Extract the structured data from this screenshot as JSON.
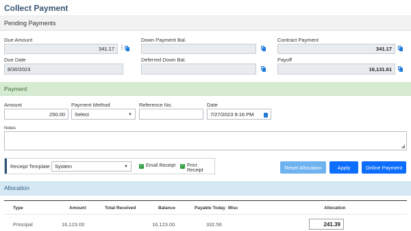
{
  "title": "Collect Payment",
  "pending": {
    "heading": "Pending Payments",
    "due_amount_label": "Due Amount",
    "due_amount_value": "341.17",
    "down_payment_bal_label": "Down Payment Bal.",
    "down_payment_bal_value": "",
    "contract_payment_label": "Contract Payment",
    "contract_payment_value": "341.17",
    "due_date_label": "Due Date",
    "due_date_value": "8/30/2023",
    "deferred_down_bal_label": "Deferred Down Bal.",
    "deferred_down_bal_value": "",
    "payoff_label": "Payoff",
    "payoff_value": "16,131.61"
  },
  "payment": {
    "heading": "Payment",
    "amount_label": "Amount",
    "amount_value": "250.00",
    "method_label": "Payment Method",
    "method_value": "Select",
    "reference_label": "Reference No.",
    "reference_value": "",
    "date_label": "Date",
    "date_value": "7/27/2023 9:16 PM",
    "notes_label": "Notes",
    "notes_value": "",
    "receipt_template_label": "Receipt Template",
    "receipt_template_value": "System",
    "email_receipt_label": "Email Receipt",
    "print_receipt_label": "Print Receipt",
    "reset_button": "Reset Allocation",
    "apply_button": "Apply",
    "online_button": "Online Payment"
  },
  "allocation": {
    "heading": "Allocation",
    "columns": [
      "Type",
      "Amount",
      "Total Received",
      "Balance",
      "Payable Today",
      "Misc",
      "Allocation"
    ],
    "rows": [
      {
        "type": "Principal",
        "amount": "16,123.00",
        "total_received": "",
        "balance": "16,123.00",
        "payable_today": "332.56",
        "misc": "",
        "allocation": "241.39"
      }
    ]
  },
  "colors": {
    "accent_blue": "#0d6efd",
    "light_blue": "#6fb2f0",
    "green_section": "#d6ebd2",
    "blue_section": "#d5e8f4",
    "check_green": "#2e9e3f"
  },
  "icons": [
    "copy-icon",
    "kebab-menu-icon",
    "calendar-icon",
    "chevron-down-icon",
    "checkbox-checked-icon",
    "resize-handle-icon"
  ]
}
